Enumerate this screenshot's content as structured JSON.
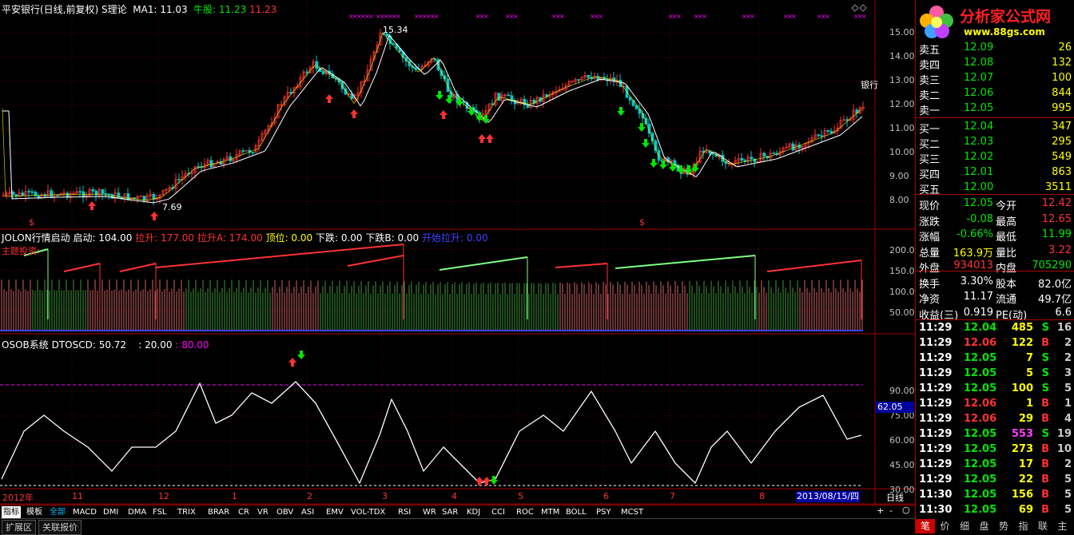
{
  "header": {
    "title": "平安银行(日线,前复权) S理论",
    "ma_label": "MA1: 11.03",
    "bull_label": "牛股:",
    "bull_value1": "11.23",
    "bull_value2": "11.23"
  },
  "price_axis": [
    "15.00",
    "14.00",
    "13.00",
    "12.00",
    "11.00",
    "10.00",
    "9.00",
    "8.00"
  ],
  "price_annotations": {
    "high": "15.34",
    "low": "7.69",
    "stock_tag": "银行"
  },
  "mid_header": {
    "name": "JOLON行情启动",
    "start": "启动: 104.00",
    "pull": "拉升: 177.00",
    "pull_a": "拉升A: 174.00",
    "top": "顶位: 0.00",
    "down": "下跌: 0.00",
    "down_b": "下跌B: 0.00",
    "begin_pull": "开始拉升: 0.00",
    "theme": "主题投资:"
  },
  "mid_axis": [
    "200.0",
    "150.0",
    "100.0",
    "50.00"
  ],
  "low_header": {
    "name": "OSOB系统",
    "dto": "DTOSCD: 50.72",
    "v1": ": 20.00",
    "v2": ": 80.00"
  },
  "low_axis": [
    "90.00",
    "75.00",
    "60.00",
    "45.00",
    "30.00"
  ],
  "low_current": "62.05",
  "date_axis": {
    "year": "2012年",
    "months": [
      "11",
      "12",
      "1",
      "2",
      "3",
      "4",
      "5",
      "6",
      "7",
      "8"
    ],
    "current_date": "2013/08/15/四",
    "period": "日线"
  },
  "logo": {
    "title": "分析家公式网",
    "url": "www.88gs.com"
  },
  "order_book": {
    "sell": [
      {
        "label": "卖五",
        "price": "12.09",
        "vol": "26"
      },
      {
        "label": "卖四",
        "price": "12.08",
        "vol": "132"
      },
      {
        "label": "卖三",
        "price": "12.07",
        "vol": "100"
      },
      {
        "label": "卖二",
        "price": "12.06",
        "vol": "844"
      },
      {
        "label": "卖一",
        "price": "12.05",
        "vol": "995"
      }
    ],
    "buy": [
      {
        "label": "买一",
        "price": "12.04",
        "vol": "347"
      },
      {
        "label": "买二",
        "price": "12.03",
        "vol": "295"
      },
      {
        "label": "买三",
        "price": "12.02",
        "vol": "549"
      },
      {
        "label": "买四",
        "price": "12.01",
        "vol": "863"
      },
      {
        "label": "买五",
        "price": "12.00",
        "vol": "3511"
      }
    ]
  },
  "quote": {
    "rows": [
      {
        "l1": "现价",
        "v1": "12.05",
        "l2": "今开",
        "v2": "12.42"
      },
      {
        "l1": "涨跌",
        "v1": "-0.08",
        "l2": "最高",
        "v2": "12.65"
      },
      {
        "l1": "涨幅",
        "v1": "-0.66%",
        "l2": "最低",
        "v2": "11.99"
      },
      {
        "l1": "总量",
        "v1": "163.9万",
        "l2": "量比",
        "v2": "3.22"
      },
      {
        "l1": "外盘",
        "v1": "934013",
        "l2": "内盘",
        "v2": "705290"
      },
      {
        "l1": "换手",
        "v1": "3.30%",
        "l2": "股本",
        "v2": "82.0亿"
      },
      {
        "l1": "净资",
        "v1": "11.17",
        "l2": "流通",
        "v2": "49.7亿"
      },
      {
        "l1": "收益(三)",
        "v1": "0.919",
        "l2": "PE(动)",
        "v2": "6.6"
      }
    ]
  },
  "ticks": [
    {
      "t": "11:29",
      "p": "12.04",
      "v": "485",
      "s": "S",
      "n": "16"
    },
    {
      "t": "11:29",
      "p": "12.06",
      "v": "122",
      "s": "B",
      "n": "2"
    },
    {
      "t": "11:29",
      "p": "12.05",
      "v": "7",
      "s": "S",
      "n": "2"
    },
    {
      "t": "11:29",
      "p": "12.05",
      "v": "5",
      "s": "S",
      "n": "3"
    },
    {
      "t": "11:29",
      "p": "12.05",
      "v": "100",
      "s": "S",
      "n": "5"
    },
    {
      "t": "11:29",
      "p": "12.06",
      "v": "1",
      "s": "B",
      "n": "1"
    },
    {
      "t": "11:29",
      "p": "12.06",
      "v": "29",
      "s": "B",
      "n": "4"
    },
    {
      "t": "11:29",
      "p": "12.05",
      "v": "553",
      "s": "S",
      "n": "19"
    },
    {
      "t": "11:29",
      "p": "12.05",
      "v": "273",
      "s": "B",
      "n": "10"
    },
    {
      "t": "11:29",
      "p": "12.05",
      "v": "17",
      "s": "B",
      "n": "2"
    },
    {
      "t": "11:29",
      "p": "12.05",
      "v": "22",
      "s": "B",
      "n": "5"
    },
    {
      "t": "11:30",
      "p": "12.05",
      "v": "156",
      "s": "B",
      "n": "5"
    },
    {
      "t": "11:30",
      "p": "12.05",
      "v": "69",
      "s": "B",
      "n": "5"
    }
  ],
  "panel_tabs": [
    "笔",
    "价",
    "细",
    "盘",
    "势",
    "指",
    "联",
    "主"
  ],
  "indicator_tabs": [
    "指标",
    "模板",
    "全部",
    "MACD",
    "DMI",
    "DMA",
    "FSL",
    "TRIX",
    "BRAR",
    "CR",
    "VR",
    "OBV",
    "ASI",
    "EMV",
    "VOL-TDX",
    "RSI",
    "WR",
    "SAR",
    "KDJ",
    "CCI",
    "ROC",
    "MTM",
    "BOLL",
    "PSY",
    "MCST"
  ],
  "bottom_tabs": [
    "扩展区",
    "关联报价"
  ],
  "colors": {
    "up": "#ff3232",
    "down": "#00e600",
    "white": "#ffffff",
    "yellow": "#ffff00",
    "magenta": "#ff00ff",
    "axis": "#a00000"
  }
}
